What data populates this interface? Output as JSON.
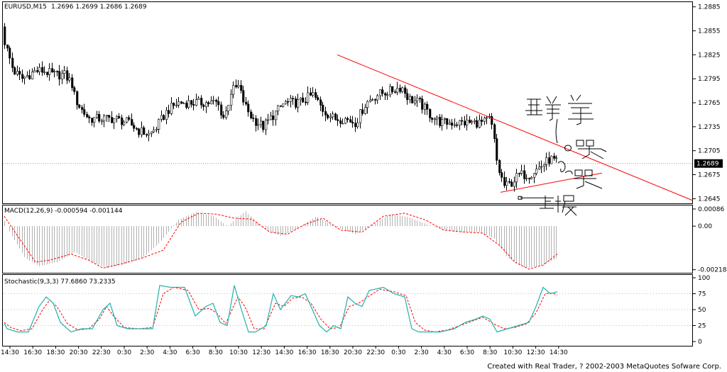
{
  "chart_data": {
    "type": "candlestick",
    "symbol_label": "EURUSD,M15",
    "ohlc_label": "1.2696 1.2699 1.2686 1.2689",
    "current_price_label": "1.2689",
    "price_ticks": [
      "1.2885",
      "1.2855",
      "1.2825",
      "1.2795",
      "1.2765",
      "1.2735",
      "1.2705",
      "1.2675",
      "1.2645"
    ],
    "ylim": [
      1.264,
      1.289
    ],
    "close_path": [
      [
        0,
        1.286
      ],
      [
        8,
        1.2835
      ],
      [
        18,
        1.2805
      ],
      [
        30,
        1.2795
      ],
      [
        40,
        1.28
      ],
      [
        50,
        1.2805
      ],
      [
        60,
        1.2805
      ],
      [
        75,
        1.28
      ],
      [
        90,
        1.28
      ],
      [
        100,
        1.279
      ],
      [
        105,
        1.277
      ],
      [
        115,
        1.2755
      ],
      [
        125,
        1.2745
      ],
      [
        140,
        1.2745
      ],
      [
        160,
        1.2745
      ],
      [
        180,
        1.274
      ],
      [
        195,
        1.273
      ],
      [
        210,
        1.2725
      ],
      [
        220,
        1.2735
      ],
      [
        235,
        1.2755
      ],
      [
        250,
        1.2765
      ],
      [
        270,
        1.2765
      ],
      [
        290,
        1.2765
      ],
      [
        305,
        1.2765
      ],
      [
        315,
        1.2745
      ],
      [
        325,
        1.278
      ],
      [
        335,
        1.2785
      ],
      [
        345,
        1.276
      ],
      [
        355,
        1.2745
      ],
      [
        370,
        1.2735
      ],
      [
        385,
        1.275
      ],
      [
        400,
        1.2765
      ],
      [
        420,
        1.2765
      ],
      [
        440,
        1.2775
      ],
      [
        455,
        1.2755
      ],
      [
        470,
        1.2745
      ],
      [
        485,
        1.2745
      ],
      [
        500,
        1.274
      ],
      [
        515,
        1.2765
      ],
      [
        530,
        1.2775
      ],
      [
        550,
        1.278
      ],
      [
        565,
        1.2785
      ],
      [
        575,
        1.277
      ],
      [
        590,
        1.2765
      ],
      [
        605,
        1.275
      ],
      [
        620,
        1.274
      ],
      [
        640,
        1.274
      ],
      [
        660,
        1.274
      ],
      [
        680,
        1.274
      ],
      [
        690,
        1.2745
      ],
      [
        695,
        1.272
      ],
      [
        700,
        1.2685
      ],
      [
        710,
        1.266
      ],
      [
        720,
        1.2665
      ],
      [
        730,
        1.2675
      ],
      [
        745,
        1.2675
      ],
      [
        760,
        1.2685
      ],
      [
        775,
        1.2695
      ],
      [
        785,
        1.2689
      ]
    ],
    "trendlines": [
      {
        "p1": [
          475,
          1.2825
        ],
        "p2": [
          975,
          1.2643
        ],
        "color": "#ff0000"
      },
      {
        "p1": [
          705,
          1.2653
        ],
        "p2": [
          848,
          1.2677
        ],
        "color": "#ff0000"
      }
    ],
    "support_line": {
      "p1": [
        733,
        1.2646
      ],
      "p2": [
        780,
        1.2646
      ],
      "color": "#000000"
    },
    "macd": {
      "label": "MACD(12,26,9) -0.000594 -0.001144",
      "ticks": [
        "0.00086",
        "0.00",
        "-0.00218"
      ],
      "ylim": [
        -0.0023,
        0.001
      ],
      "hist_path": [
        [
          0,
          0.0007
        ],
        [
          15,
          -0.0004
        ],
        [
          35,
          -0.0016
        ],
        [
          55,
          -0.002
        ],
        [
          80,
          -0.0018
        ],
        [
          105,
          -0.0013
        ],
        [
          130,
          -0.0018
        ],
        [
          150,
          -0.0021
        ],
        [
          175,
          -0.0019
        ],
        [
          200,
          -0.0016
        ],
        [
          225,
          -0.0008
        ],
        [
          250,
          0.0003
        ],
        [
          275,
          0.0007
        ],
        [
          300,
          0.0005
        ],
        [
          320,
          0.0
        ],
        [
          345,
          0.00075
        ],
        [
          370,
          -0.0001
        ],
        [
          395,
          -0.0005
        ],
        [
          420,
          -0.0001
        ],
        [
          445,
          0.0005
        ],
        [
          470,
          0.0
        ],
        [
          500,
          -0.0004
        ],
        [
          525,
          0.0001
        ],
        [
          550,
          0.0006
        ],
        [
          575,
          0.00045
        ],
        [
          600,
          0.0001
        ],
        [
          625,
          -0.0002
        ],
        [
          650,
          -0.0003
        ],
        [
          675,
          -0.0003
        ],
        [
          695,
          -0.0006
        ],
        [
          715,
          -0.0016
        ],
        [
          740,
          -0.0021
        ],
        [
          760,
          -0.002
        ],
        [
          785,
          -0.0016
        ]
      ],
      "signal_path": [
        [
          0,
          0.0005
        ],
        [
          25,
          -0.0005
        ],
        [
          50,
          -0.0018
        ],
        [
          70,
          -0.0017
        ],
        [
          100,
          -0.0014
        ],
        [
          125,
          -0.0017
        ],
        [
          145,
          -0.0021
        ],
        [
          170,
          -0.0019
        ],
        [
          200,
          -0.0016
        ],
        [
          230,
          -0.0012
        ],
        [
          255,
          0.0002
        ],
        [
          280,
          0.00065
        ],
        [
          305,
          0.0006
        ],
        [
          330,
          0.0004
        ],
        [
          355,
          0.00035
        ],
        [
          380,
          -0.0003
        ],
        [
          405,
          -0.0004
        ],
        [
          430,
          0.0001
        ],
        [
          455,
          0.0004
        ],
        [
          480,
          -0.0002
        ],
        [
          510,
          -0.0003
        ],
        [
          540,
          0.0005
        ],
        [
          570,
          0.00065
        ],
        [
          600,
          0.0003
        ],
        [
          625,
          -0.0002
        ],
        [
          655,
          -0.0003
        ],
        [
          680,
          -0.00035
        ],
        [
          705,
          -0.001
        ],
        [
          725,
          -0.0018
        ],
        [
          745,
          -0.00215
        ],
        [
          765,
          -0.00195
        ],
        [
          785,
          -0.0014
        ]
      ]
    },
    "stochastic": {
      "label": "Stochastic(9,3,3) 77.6860 73.2335",
      "ticks": [
        "100",
        "75",
        "50",
        "25",
        "0"
      ],
      "ylim": [
        0,
        100
      ],
      "k_path": [
        [
          0,
          28
        ],
        [
          10,
          20
        ],
        [
          25,
          15
        ],
        [
          40,
          15
        ],
        [
          55,
          55
        ],
        [
          65,
          70
        ],
        [
          75,
          60
        ],
        [
          85,
          30
        ],
        [
          100,
          15
        ],
        [
          115,
          20
        ],
        [
          130,
          20
        ],
        [
          145,
          50
        ],
        [
          155,
          60
        ],
        [
          165,
          25
        ],
        [
          180,
          20
        ],
        [
          200,
          20
        ],
        [
          215,
          20
        ],
        [
          225,
          88
        ],
        [
          240,
          85
        ],
        [
          260,
          85
        ],
        [
          275,
          40
        ],
        [
          290,
          55
        ],
        [
          300,
          60
        ],
        [
          310,
          30
        ],
        [
          320,
          25
        ],
        [
          330,
          88
        ],
        [
          340,
          50
        ],
        [
          350,
          15
        ],
        [
          360,
          15
        ],
        [
          375,
          25
        ],
        [
          385,
          75
        ],
        [
          395,
          50
        ],
        [
          410,
          72
        ],
        [
          420,
          70
        ],
        [
          430,
          75
        ],
        [
          440,
          50
        ],
        [
          450,
          25
        ],
        [
          460,
          15
        ],
        [
          470,
          25
        ],
        [
          480,
          20
        ],
        [
          490,
          70
        ],
        [
          500,
          60
        ],
        [
          510,
          55
        ],
        [
          520,
          80
        ],
        [
          540,
          85
        ],
        [
          555,
          75
        ],
        [
          570,
          70
        ],
        [
          580,
          20
        ],
        [
          590,
          15
        ],
        [
          605,
          15
        ],
        [
          620,
          15
        ],
        [
          640,
          20
        ],
        [
          655,
          30
        ],
        [
          670,
          35
        ],
        [
          680,
          40
        ],
        [
          690,
          35
        ],
        [
          700,
          15
        ],
        [
          715,
          20
        ],
        [
          730,
          25
        ],
        [
          745,
          30
        ],
        [
          755,
          55
        ],
        [
          765,
          85
        ],
        [
          775,
          75
        ],
        [
          785,
          78
        ]
      ],
      "d_path": [
        [
          0,
          30
        ],
        [
          15,
          22
        ],
        [
          30,
          17
        ],
        [
          45,
          20
        ],
        [
          60,
          50
        ],
        [
          70,
          65
        ],
        [
          80,
          55
        ],
        [
          95,
          28
        ],
        [
          110,
          18
        ],
        [
          125,
          20
        ],
        [
          140,
          35
        ],
        [
          150,
          55
        ],
        [
          160,
          40
        ],
        [
          175,
          22
        ],
        [
          195,
          20
        ],
        [
          215,
          22
        ],
        [
          230,
          75
        ],
        [
          245,
          85
        ],
        [
          265,
          80
        ],
        [
          280,
          50
        ],
        [
          295,
          52
        ],
        [
          305,
          45
        ],
        [
          318,
          28
        ],
        [
          335,
          70
        ],
        [
          345,
          55
        ],
        [
          358,
          20
        ],
        [
          372,
          20
        ],
        [
          388,
          60
        ],
        [
          400,
          55
        ],
        [
          412,
          68
        ],
        [
          425,
          70
        ],
        [
          438,
          60
        ],
        [
          452,
          35
        ],
        [
          465,
          20
        ],
        [
          478,
          22
        ],
        [
          492,
          55
        ],
        [
          505,
          60
        ],
        [
          518,
          70
        ],
        [
          535,
          82
        ],
        [
          555,
          78
        ],
        [
          572,
          72
        ],
        [
          585,
          30
        ],
        [
          598,
          18
        ],
        [
          612,
          15
        ],
        [
          630,
          18
        ],
        [
          648,
          25
        ],
        [
          665,
          32
        ],
        [
          680,
          38
        ],
        [
          695,
          28
        ],
        [
          710,
          20
        ],
        [
          725,
          22
        ],
        [
          742,
          28
        ],
        [
          755,
          45
        ],
        [
          768,
          75
        ],
        [
          778,
          76
        ],
        [
          785,
          73
        ]
      ]
    },
    "time_ticks": [
      "14:30",
      "16:30",
      "18:30",
      "20:30",
      "22:30",
      "0:30",
      "2:30",
      "4:30",
      "6:30",
      "8:30",
      "10:30",
      "12:30",
      "14:30",
      "16:30",
      "18:30",
      "20:30",
      "22:30",
      "0:30",
      "2:30",
      "4:30",
      "6:30",
      "8:30",
      "10:30",
      "12:30",
      "14:30"
    ],
    "handwritten_notes": [
      "再等等",
      "o买",
      "买",
      "止损"
    ]
  },
  "footer": {
    "credit": "Created with Real Trader, ? 2002-2003 MetaQuotes Sofware Corp."
  }
}
